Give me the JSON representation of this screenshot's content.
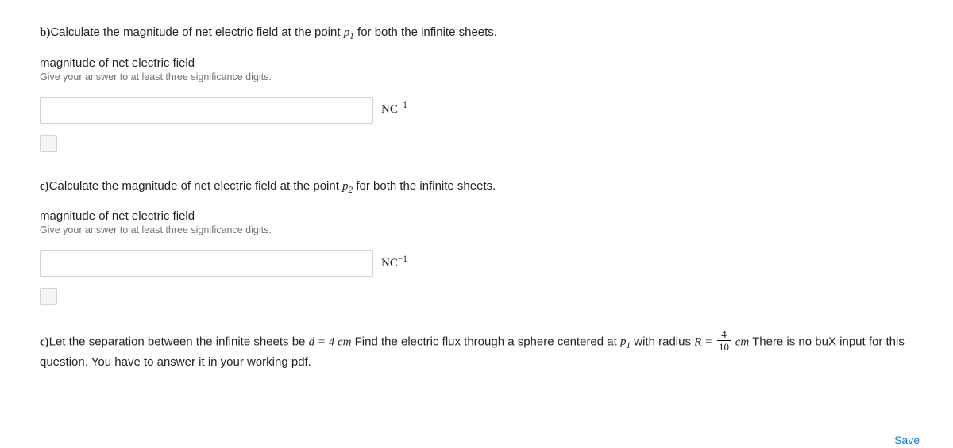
{
  "partB": {
    "label": "b)",
    "prompt_before": "Calculate the magnitude of net electric field at the point ",
    "point_var": "p",
    "point_sub": "1",
    "prompt_after": " for both the infinite sheets.",
    "sublabel": "magnitude of net electric field",
    "hint": "Give your answer to at least three significance digits.",
    "unit_base": "NC",
    "unit_exp": "−1"
  },
  "partC1": {
    "label": "c)",
    "prompt_before": "Calculate the magnitude of net electric field at the point ",
    "point_var": "p",
    "point_sub": "2",
    "prompt_after": " for both the infinite sheets.",
    "sublabel": "magnitude of net electric field",
    "hint": "Give your answer to at least three significance digits.",
    "unit_base": "NC",
    "unit_exp": "−1"
  },
  "partC2": {
    "label": "c)",
    "text1": "Let the separation between the infinite sheets be ",
    "d_var": "d",
    "eq": " = ",
    "d_val": "4",
    "d_unit": " cm",
    "text2": " Find the electric flux through a sphere centered at  ",
    "p_var": "p",
    "p_sub": "1",
    "text3": "  with radius ",
    "r_var": "R",
    "frac_num": "4",
    "frac_den": "10",
    "r_unit": " cm",
    "text4": " There is no buX input for this question. You have to answer it in your working pdf."
  },
  "save": "Save"
}
